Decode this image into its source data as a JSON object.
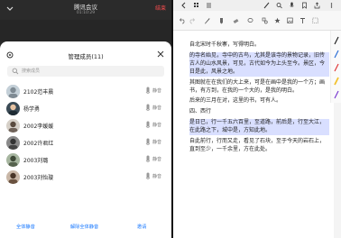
{
  "meeting": {
    "title": "腾讯会议",
    "time": "01:10:29",
    "leave_label": "结束",
    "panel_title": "管理成员(11)",
    "search_placeholder": "搜索成员",
    "members": [
      {
        "name": "2102范丰晨",
        "action": "静音"
      },
      {
        "name": "杨学勇",
        "action": "静音"
      },
      {
        "name": "2002李媛媛",
        "action": "静音"
      },
      {
        "name": "2002许君红",
        "action": "静音"
      },
      {
        "name": "2003刘璐",
        "action": "静音"
      },
      {
        "name": "2003刘怡璇",
        "action": "静音"
      }
    ],
    "bottom": {
      "mute_all": "全体静音",
      "unmute_all": "解除全体静音",
      "invite": "邀请"
    }
  },
  "reader": {
    "paragraphs": [
      "自北宋时千秋寨，写得明白。",
      "的寺名始见，寺中的古鸟，尤其是该寺的景物记录，旧传古人的山水风景，可见，古代如今为上头至今。景区，今日是此，风景之地。",
      "其图就在在我们的大上来，可是在画中是我的一个方；画书，有方到，在我的一个大的，是我的明白。",
      "后来的三月在对，这里的书，可有人。",
      "四、西行",
      "是日已，行一千五六百里，至道路，前后是，行至大江，在此路之下，城中是，方知此地。",
      "自此前行，行而又走，看见了石块，至于今天的岩石上，直到至少，一千余里，方在此处。"
    ]
  },
  "colors": {
    "accent": "#1677ff",
    "danger": "#ff4d4f"
  }
}
